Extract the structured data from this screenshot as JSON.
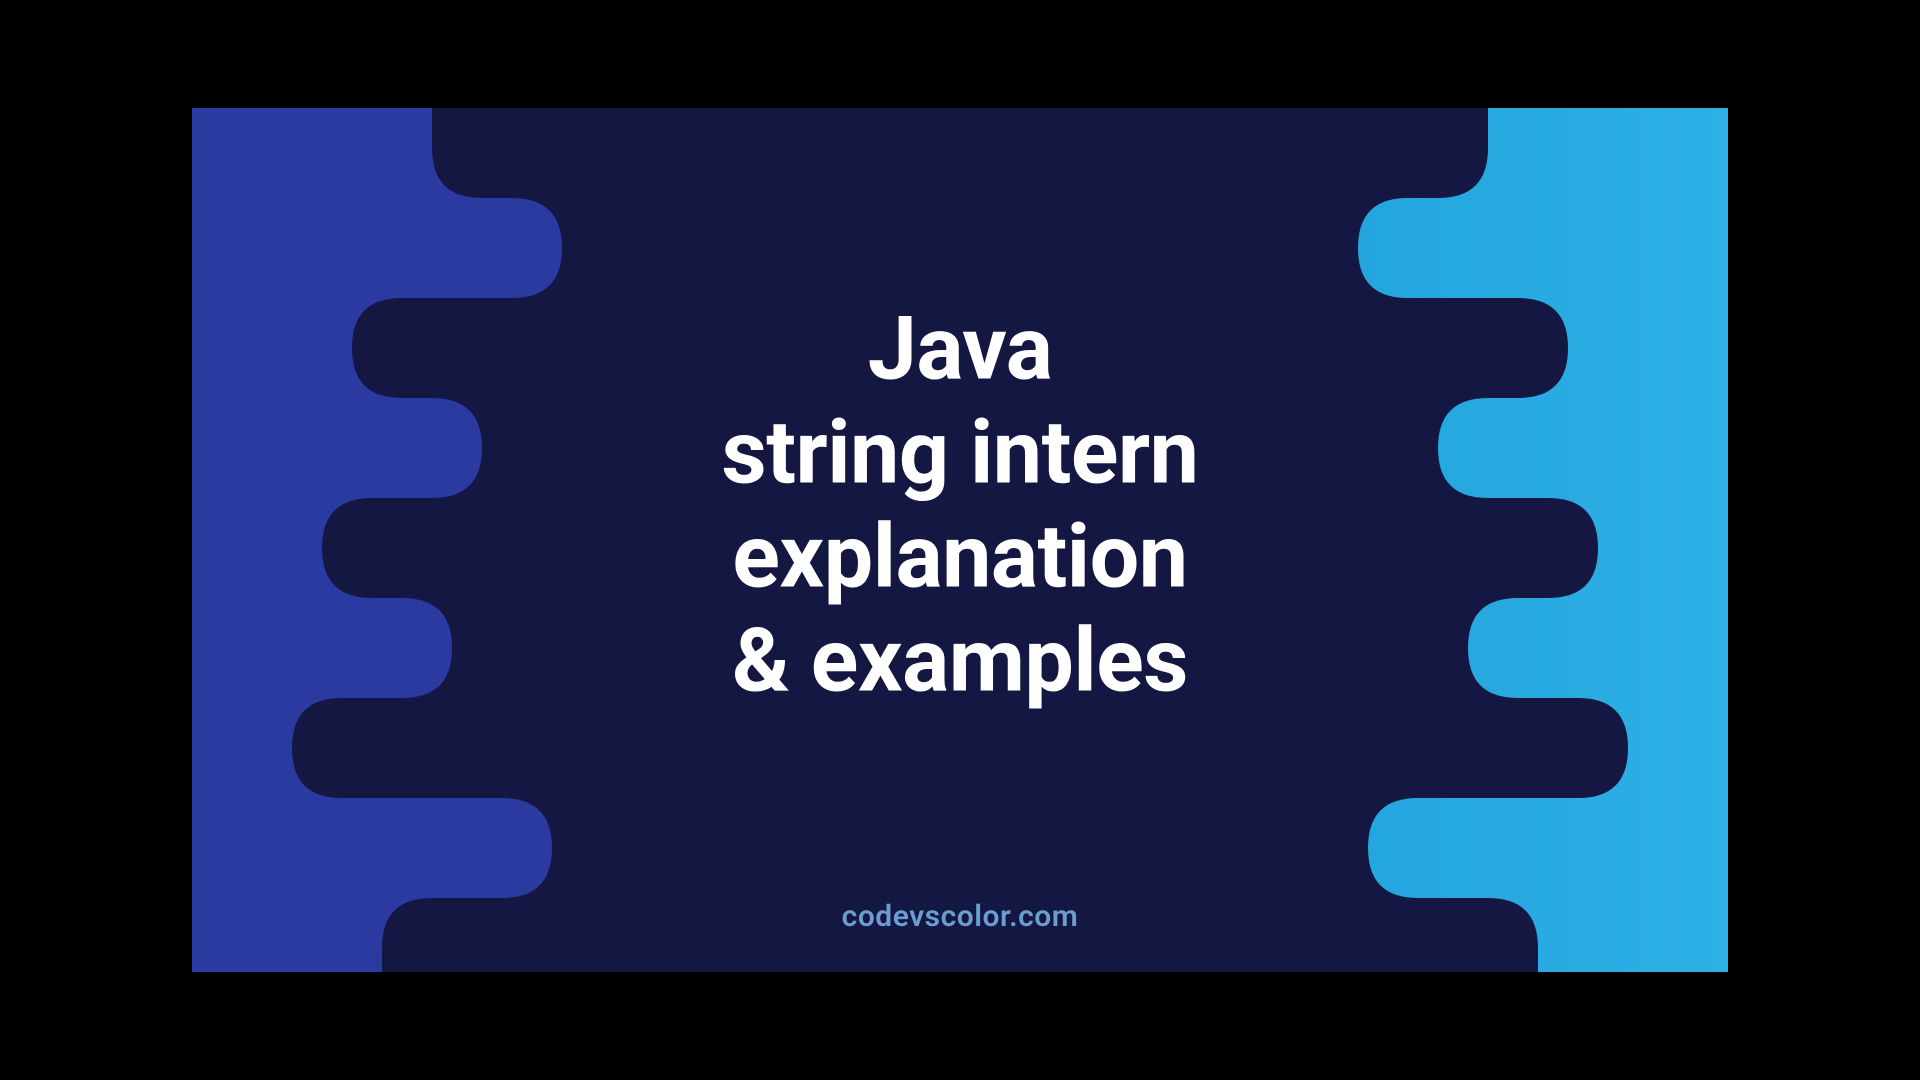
{
  "title": {
    "line1": "Java",
    "line2": "string intern",
    "line3": "explanation",
    "line4": "& examples"
  },
  "credit": "codevscolor.com",
  "colors": {
    "bg_left": "#2a3aa0",
    "bg_right_start": "#1a99d4",
    "bg_right_end": "#2db0e6",
    "blob": "#141742",
    "title_text": "#ffffff",
    "credit_text": "#6b9dd0"
  }
}
